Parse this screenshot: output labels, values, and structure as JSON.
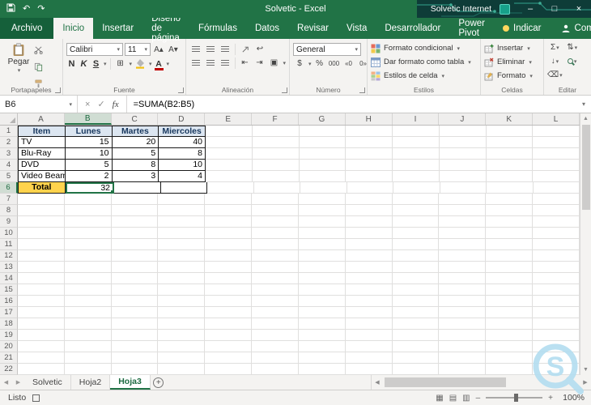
{
  "titlebar": {
    "title": "Solvetic  -  Excel",
    "brand": "Solvetic Internet",
    "minimize": "–",
    "maximize": "□",
    "close": "×"
  },
  "glyphs": {
    "undo": "↶",
    "redo": "↷",
    "dropdown": "▾",
    "sum": "Σ",
    "fill_down": "↓",
    "clear": "⌫",
    "sort": "⇅",
    "wrap": "↩",
    "indent_left": "⇤",
    "indent_right": "⇥",
    "merge": "▣",
    "borders": "⊞",
    "font_increase": "A▴",
    "font_decrease": "A▾",
    "font_color_letter": "A",
    "currency": "$",
    "percent": "%",
    "thousands": "000",
    "dec_increase": "«0",
    "dec_decrease": "0»",
    "cancel": "×",
    "check": "✓",
    "fx": "fx",
    "up": "▲",
    "down": "▼",
    "left": "◀",
    "right": "▶",
    "view_normal": "▦",
    "view_layout": "▤",
    "view_break": "▥",
    "zoom_minus": "–",
    "zoom_plus": "+",
    "add_sheet": "+"
  },
  "tabs": {
    "file": "Archivo",
    "items": [
      "Inicio",
      "Insertar",
      "Diseño de página",
      "Fórmulas",
      "Datos",
      "Revisar",
      "Vista",
      "Desarrollador",
      "Power Pivot"
    ],
    "tellme": "Indicar",
    "share": "Compartir"
  },
  "ribbon": {
    "paste": "Pegar",
    "groups": [
      "Portapapeles",
      "Fuente",
      "Alineación",
      "Número",
      "Estilos",
      "Celdas",
      "Editar"
    ],
    "font_name": "Calibri",
    "font_size": "11",
    "bold": "N",
    "italic": "K",
    "underline": "S",
    "number_format": "General",
    "styles": [
      "Formato condicional",
      "Dar formato como tabla",
      "Estilos de celda"
    ],
    "cells": [
      "Insertar",
      "Eliminar",
      "Formato"
    ]
  },
  "formula_bar": {
    "name_box": "B6",
    "formula": "=SUMA(B2:B5)"
  },
  "sheet": {
    "columns": [
      "A",
      "B",
      "C",
      "D",
      "E",
      "F",
      "G",
      "H",
      "I",
      "J",
      "K",
      "L"
    ],
    "row_count": 22,
    "selected_column": "B",
    "selected_row": 6,
    "selected_cell": "B6",
    "table": {
      "headers": [
        "Item",
        "Lunes",
        "Martes",
        "Miercoles"
      ],
      "rows": [
        [
          "TV",
          "15",
          "20",
          "40"
        ],
        [
          "Blu-Ray",
          "10",
          "5",
          "8"
        ],
        [
          "DVD",
          "5",
          "8",
          "10"
        ],
        [
          "Video Beam",
          "2",
          "3",
          "4"
        ]
      ],
      "total": [
        "Total",
        "32",
        "",
        ""
      ]
    }
  },
  "sheet_tabs": {
    "items": [
      "Solvetic",
      "Hoja2",
      "Hoja3"
    ],
    "active": "Hoja3"
  },
  "status": {
    "ready": "Listo",
    "zoom": "100%"
  },
  "watermark": {
    "letter": "S"
  },
  "colors": {
    "accent": "#217346",
    "table_header_fill": "#dce6f1",
    "total_fill": "#ffd34d"
  }
}
